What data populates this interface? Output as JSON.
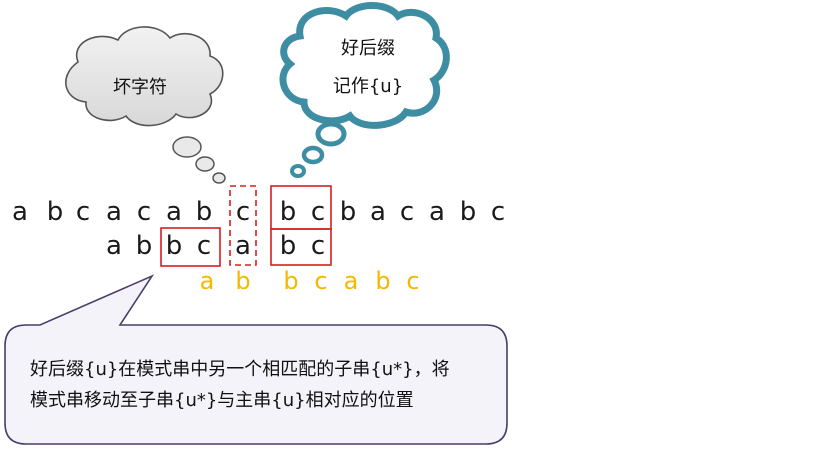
{
  "clouds": {
    "bad_char": {
      "label": "坏字符"
    },
    "good_suffix": {
      "line1": "好后缀",
      "line2": "记作{u}"
    }
  },
  "main_string": [
    "a",
    "b",
    "c",
    "a",
    "c",
    "a",
    "b",
    "c",
    "b",
    "c",
    "b",
    "a",
    "c",
    "a",
    "b",
    "c"
  ],
  "pattern_string": [
    "a",
    "b",
    "b",
    "c",
    "a",
    "b",
    "c"
  ],
  "shifted_pattern": [
    "a",
    "b",
    "b",
    "c",
    "a",
    "b",
    "c"
  ],
  "callout": {
    "line1": "好后缀{u}在模式串中另一个相匹配的子串{u*}，将",
    "line2": "模式串移动至子串{u*}与主串{u}相对应的位置"
  },
  "colors": {
    "gray_cloud_fill": "#e6e6e6",
    "gray_cloud_stroke": "#555555",
    "teal_cloud_stroke": "#3e8ea3",
    "highlight_red": "#d42020",
    "shift_yellow": "#f5b800",
    "callout_fill": "#f4f3fa",
    "callout_stroke": "#4a3d6a"
  }
}
